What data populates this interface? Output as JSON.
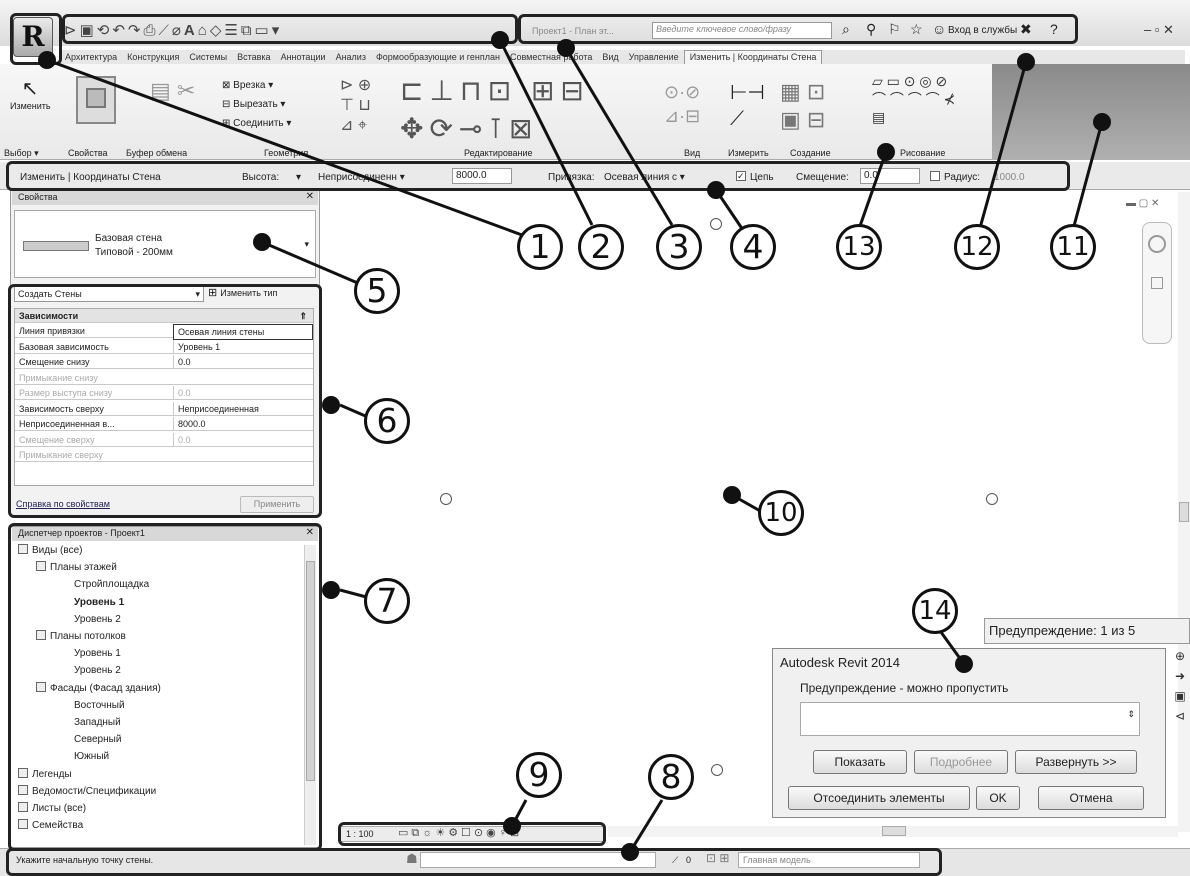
{
  "qat": {
    "app_button": "R"
  },
  "infocenter": {
    "path": "Проект1 - План эт...",
    "search_placeholder": "Введите ключевое слово/фразу",
    "signin": "Вход в службы"
  },
  "ribbon": {
    "tabs": [
      "Архитектура",
      "Конструкция",
      "Системы",
      "Вставка",
      "Аннотации",
      "Анализ",
      "Формообразующие и генплан",
      "Совместная работа",
      "Вид",
      "Управление",
      "Изменить | Координаты Стена"
    ],
    "panels": [
      "Выбор ▾",
      "Свойства",
      "Буфер обмена",
      "Геометрия",
      "Редактирование",
      "Вид",
      "Измерить",
      "Создание",
      "Рисование"
    ],
    "modify_label": "Изменить",
    "geom": [
      "Врезка ▾",
      "Вырезать ▾",
      "Соединить ▾"
    ]
  },
  "optbar": {
    "context": "Изменить | Координаты Стена",
    "height_label": "Высота:",
    "unconnected": "Неприсоединенн ▾",
    "value": "8000.0",
    "snap_label": "Привязка:",
    "snap_value": "Осевая линия с ▾",
    "chain": "Цепь",
    "offset_label": "Смещение:",
    "offset_value": "0.0",
    "radius_label": "Радиус:",
    "radius_value": "1000.0"
  },
  "props": {
    "title": "Свойства",
    "type_name": "Базовая стена",
    "type_sub": "Типовой - 200мм",
    "filter": "Создать Стены",
    "edit_type": "Изменить тип",
    "group": "Зависимости",
    "rows": [
      {
        "k": "Линия привязки",
        "v": "Осевая линия стены",
        "dim": false
      },
      {
        "k": "Базовая зависимость",
        "v": "Уровень 1",
        "dim": false
      },
      {
        "k": "Смещение снизу",
        "v": "0.0",
        "dim": false
      },
      {
        "k": "Примыкание снизу",
        "v": "",
        "dim": true
      },
      {
        "k": "Размер выступа снизу",
        "v": "0.0",
        "dim": true
      },
      {
        "k": "Зависимость сверху",
        "v": "Неприсоединенная",
        "dim": false
      },
      {
        "k": "Неприсоединенная в...",
        "v": "8000.0",
        "dim": false
      },
      {
        "k": "Смещение сверху",
        "v": "0.0",
        "dim": true
      },
      {
        "k": "Примыкание сверху",
        "v": "",
        "dim": true
      }
    ],
    "help": "Справка по свойствам",
    "apply": "Применить"
  },
  "browser": {
    "title": "Диспетчер проектов - Проект1",
    "items": [
      {
        "t": "Виды (все)",
        "lvl": 0,
        "b": false
      },
      {
        "t": "Планы этажей",
        "lvl": 1,
        "b": false
      },
      {
        "t": "Стройплощадка",
        "lvl": 2,
        "b": false
      },
      {
        "t": "Уровень 1",
        "lvl": 2,
        "b": true
      },
      {
        "t": "Уровень 2",
        "lvl": 2,
        "b": false
      },
      {
        "t": "Планы потолков",
        "lvl": 1,
        "b": false
      },
      {
        "t": "Уровень 1",
        "lvl": 2,
        "b": false
      },
      {
        "t": "Уровень 2",
        "lvl": 2,
        "b": false
      },
      {
        "t": "Фасады (Фасад здания)",
        "lvl": 1,
        "b": false
      },
      {
        "t": "Восточный",
        "lvl": 2,
        "b": false
      },
      {
        "t": "Западный",
        "lvl": 2,
        "b": false
      },
      {
        "t": "Северный",
        "lvl": 2,
        "b": false
      },
      {
        "t": "Южный",
        "lvl": 2,
        "b": false
      },
      {
        "t": "Легенды",
        "lvl": 0,
        "b": false
      },
      {
        "t": "Ведомости/Спецификации",
        "lvl": 0,
        "b": false
      },
      {
        "t": "Листы (все)",
        "lvl": 0,
        "b": false
      },
      {
        "t": "Семейства",
        "lvl": 0,
        "b": false
      }
    ]
  },
  "viewbar": {
    "scale": "1 : 100"
  },
  "status": {
    "text": "Укажите начальную точку стены.",
    "zero": "0",
    "model": "Главная модель"
  },
  "warning": {
    "counter": "Предупреждение: 1 из 5",
    "title": "Autodesk Revit 2014",
    "msg": "Предупреждение - можно пропустить",
    "show": "Показать",
    "more": "Подробнее",
    "expand": "Развернуть >>",
    "unjoin": "Отсоединить элементы",
    "ok": "OK",
    "cancel": "Отмена"
  },
  "callouts": {
    "c1": "1",
    "c2": "2",
    "c3": "3",
    "c4": "4",
    "c5": "5",
    "c6": "6",
    "c7": "7",
    "c8": "8",
    "c9": "9",
    "c10": "10",
    "c11": "11",
    "c12": "12",
    "c13": "13",
    "c14": "14"
  }
}
